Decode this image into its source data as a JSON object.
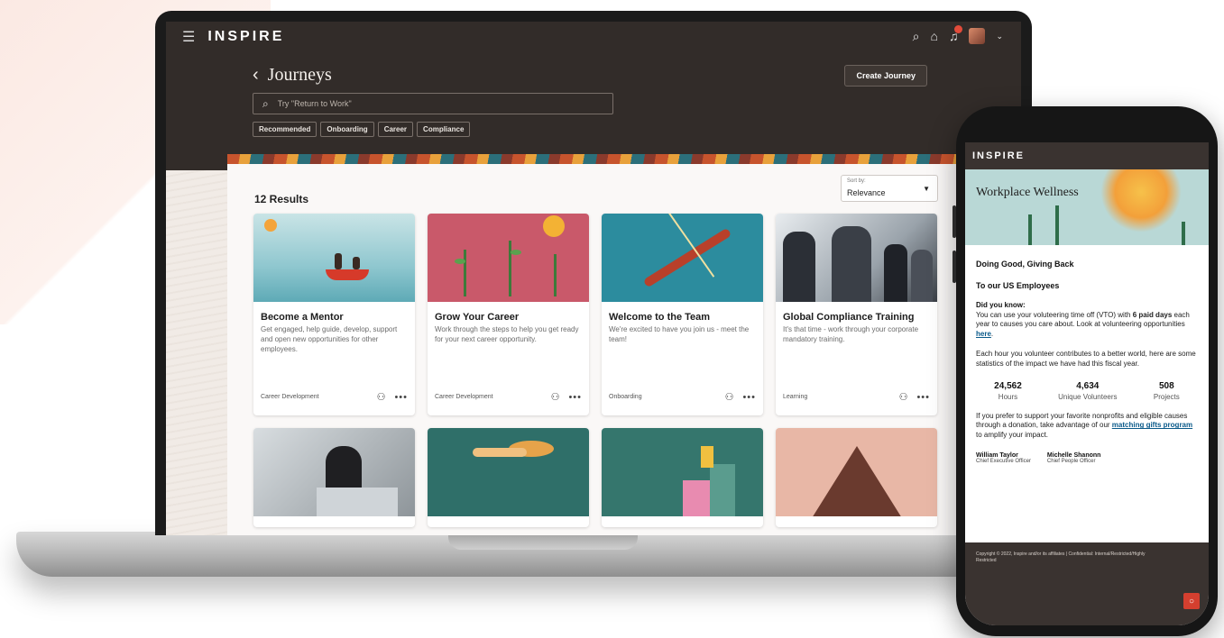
{
  "app": {
    "brand": "INSPIRE",
    "menu_icon": "hamburger-icon",
    "top_icons": [
      "search-icon",
      "home-icon",
      "notifications-icon",
      "avatar"
    ]
  },
  "header": {
    "title": "Journeys",
    "create_button": "Create Journey",
    "search_placeholder": "Try \"Return to Work\"",
    "chips": [
      "Recommended",
      "Onboarding",
      "Career",
      "Compliance"
    ]
  },
  "results": {
    "count_label": "12 Results",
    "sort_label": "Sort by:",
    "sort_value": "Relevance"
  },
  "cards": [
    {
      "title": "Become a Mentor",
      "description": "Get engaged, help guide, develop, support and open new opportunities for other employees.",
      "category": "Career Development"
    },
    {
      "title": "Grow Your Career",
      "description": "Work through the steps to help you get ready for your next career opportunity.",
      "category": "Career Development"
    },
    {
      "title": "Welcome to the Team",
      "description": "We're excited to have you join us - meet the team!",
      "category": "Onboarding"
    },
    {
      "title": "Global Compliance Training",
      "description": "It's that time - work through your corporate mandatory training.",
      "category": "Learning"
    }
  ],
  "phone": {
    "brand": "INSPIRE",
    "hero_title": "Workplace Wellness",
    "heading1": "Doing Good, Giving Back",
    "heading2": "To our US Employees",
    "did_you_know": "Did you know:",
    "para1_a": "You can use your voluteering time off (VTO) with ",
    "para1_bold": "6 paid days",
    "para1_b": " each year to causes you care about. Look at volunteering opportunities ",
    "para1_link": "here",
    "para1_end": ".",
    "para2": "Each hour you volunteer contributes to a better world, here are some statistics of the impact we have had this fiscal year.",
    "stats": [
      {
        "value": "24,562",
        "label": "Hours"
      },
      {
        "value": "4,634",
        "label": "Unique Volunteers"
      },
      {
        "value": "508",
        "label": "Projects"
      }
    ],
    "para3_a": "If you prefer to support your favorite nonprofits and eligible causes through a donation, take advantage of our ",
    "para3_link": "matching gifts program",
    "para3_b": " to amplify your impact.",
    "signers": [
      {
        "name": "William Taylor",
        "role": "Chief Executive Officer"
      },
      {
        "name": "Michelle Shanonn",
        "role": "Chief People Officer"
      }
    ],
    "copyright": "Copyright © 2022, Inspire and/or its affiliates | Confidential: Internal/Restricted/Highly Restricted"
  },
  "colors": {
    "dark_bg": "#322c29",
    "accent_red": "#d43f2f",
    "link": "#0a5a8a"
  }
}
